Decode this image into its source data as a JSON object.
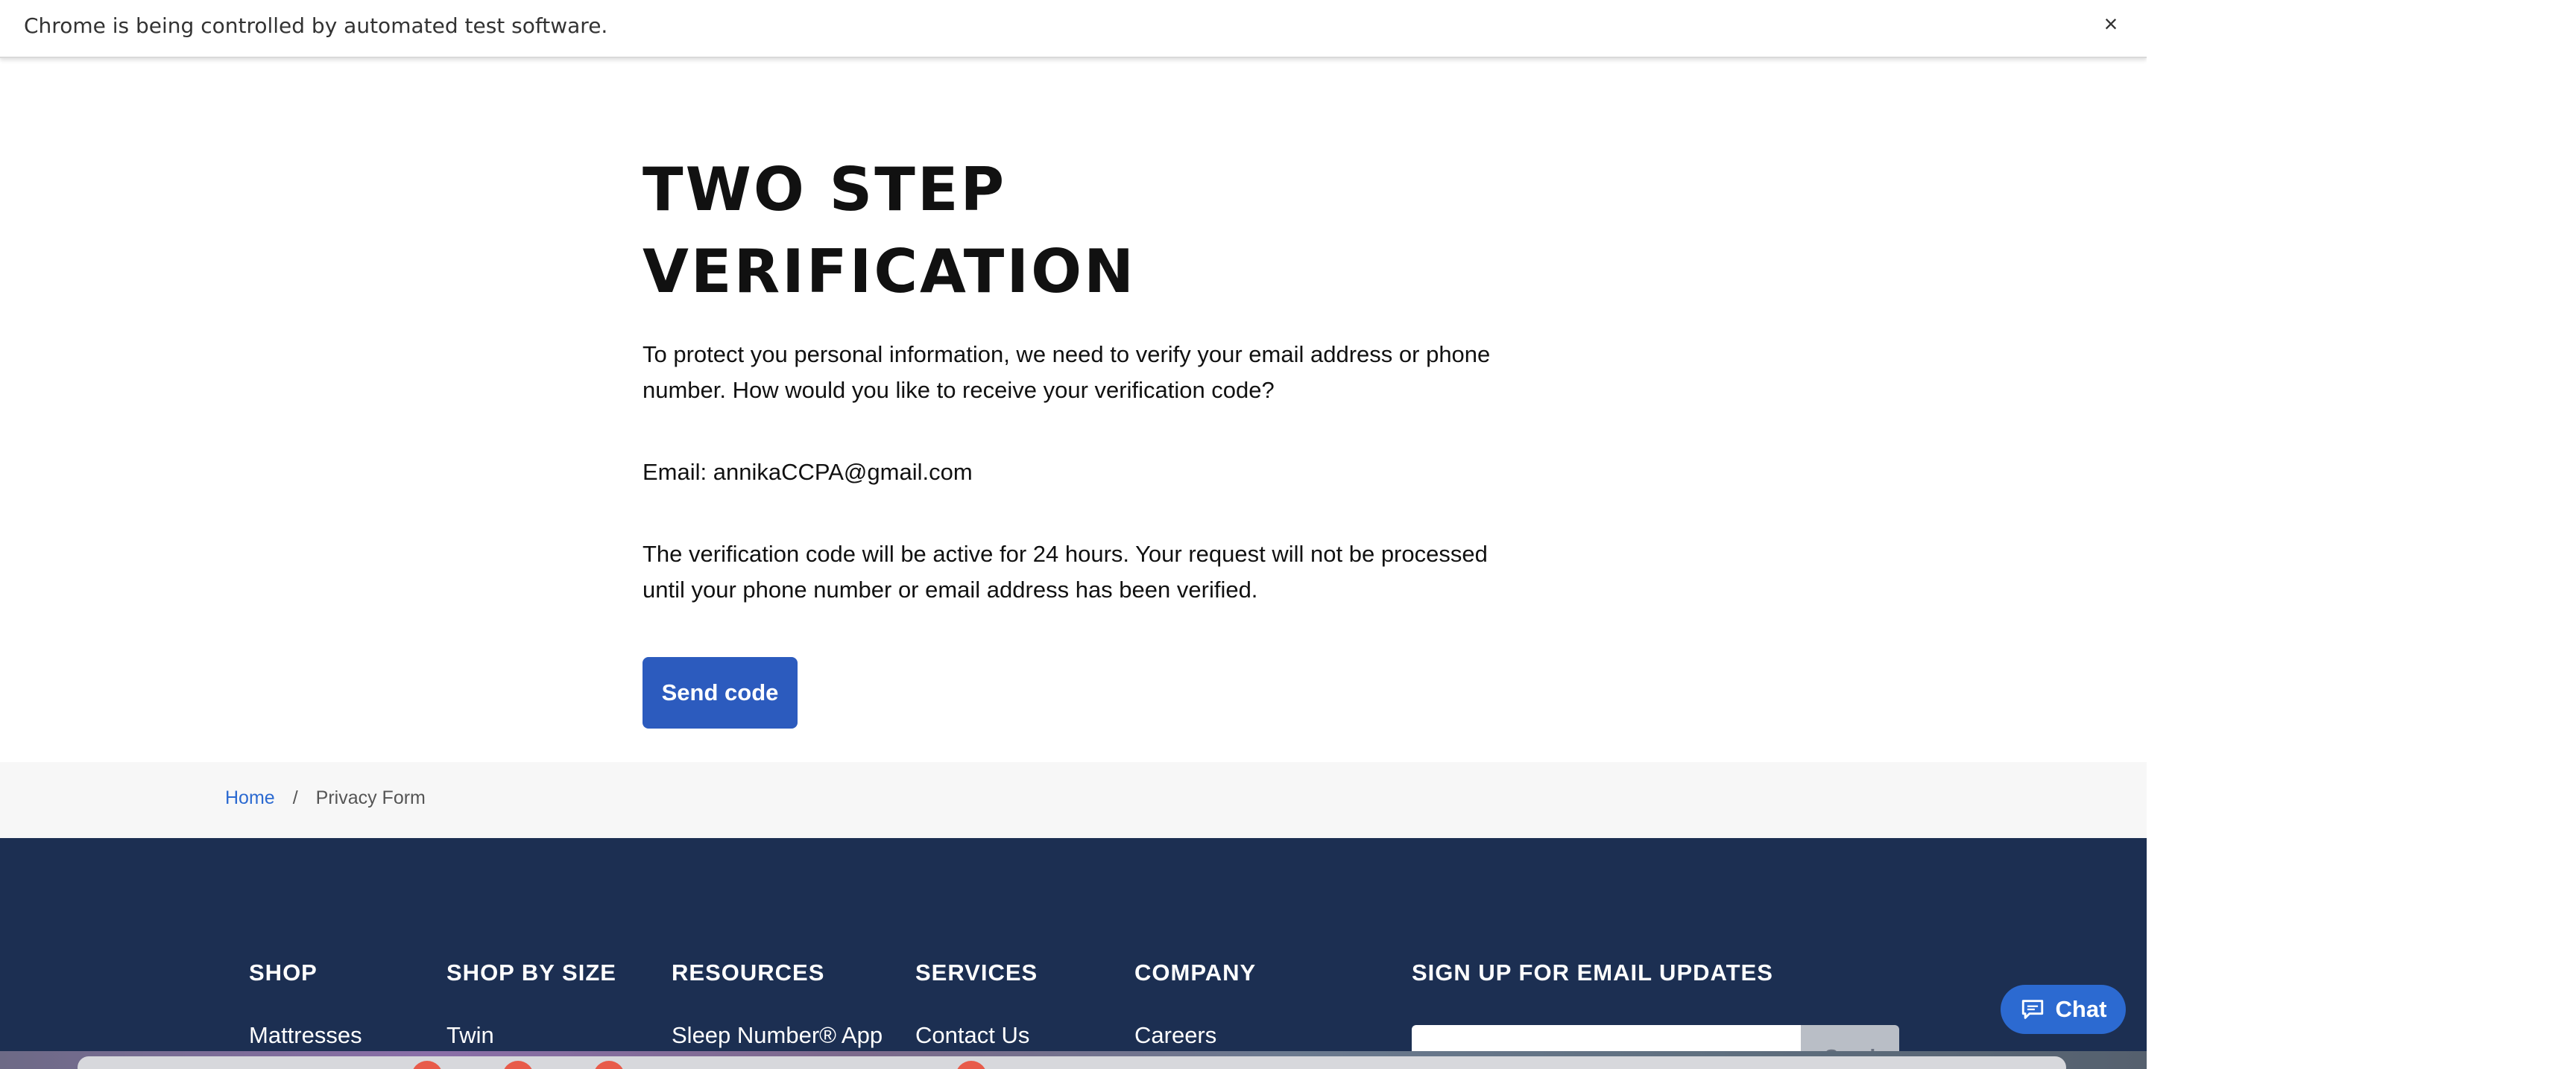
{
  "automation_bar": {
    "message": "Chrome is being controlled by automated test software.",
    "close_glyph": "×"
  },
  "main": {
    "title": "TWO STEP VERIFICATION",
    "intro": "To protect you personal information, we need to verify your email address or phone number. How would you like to receive your verification code?",
    "email_line": "Email: annikaCCPA@gmail.com",
    "notice": "The verification code will be active for 24 hours. Your request will not be processed until your phone number or email address has been verified.",
    "send_button": "Send code"
  },
  "breadcrumb": {
    "home": "Home",
    "separator": "/",
    "current": "Privacy Form"
  },
  "footer": {
    "columns": [
      {
        "heading": "SHOP",
        "first_link": "Mattresses"
      },
      {
        "heading": "SHOP BY SIZE",
        "first_link": "Twin"
      },
      {
        "heading": "RESOURCES",
        "first_link": "Sleep Number® App"
      },
      {
        "heading": "SERVICES",
        "first_link": "Contact Us"
      },
      {
        "heading": "COMPANY",
        "first_link": "Careers"
      }
    ],
    "email_signup": {
      "heading": "SIGN UP FOR EMAIL UPDATES",
      "input_value": "",
      "button": "Send"
    }
  },
  "chat": {
    "label": "Chat",
    "icon": "chat-bubble-icon"
  },
  "colors": {
    "primary_button": "#2c5bbe",
    "link": "#2c6ad1",
    "footer_bg": "#1c2f52",
    "breadcrumb_bg": "#f7f7f7"
  }
}
